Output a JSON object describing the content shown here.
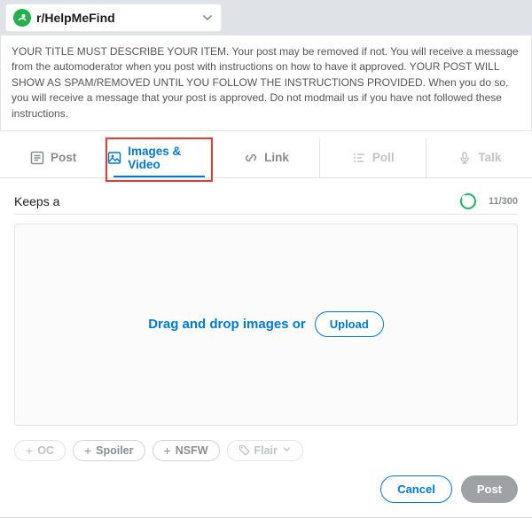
{
  "community": {
    "name": "r/HelpMeFind"
  },
  "notice": "YOUR TITLE MUST DESCRIBE YOUR ITEM. Your post may be removed if not. You will receive a message from the automoderator when you post with instructions on how to have it approved. YOUR POST WILL SHOW AS SPAM/REMOVED UNTIL YOU FOLLOW THE INSTRUCTIONS PROVIDED. When you do so, you will receive a message that your post is approved. Do not modmail us if you have not followed these instructions.",
  "tabs": {
    "post": "Post",
    "images": "Images & Video",
    "link": "Link",
    "poll": "Poll",
    "talk": "Talk"
  },
  "title": {
    "value": "Keeps a",
    "counter": "11/300"
  },
  "dropzone": {
    "text": "Drag and drop images or",
    "upload": "Upload"
  },
  "tags": {
    "oc": "OC",
    "spoiler": "Spoiler",
    "nsfw": "NSFW",
    "flair": "Flair"
  },
  "footer": {
    "cancel": "Cancel",
    "post": "Post"
  }
}
